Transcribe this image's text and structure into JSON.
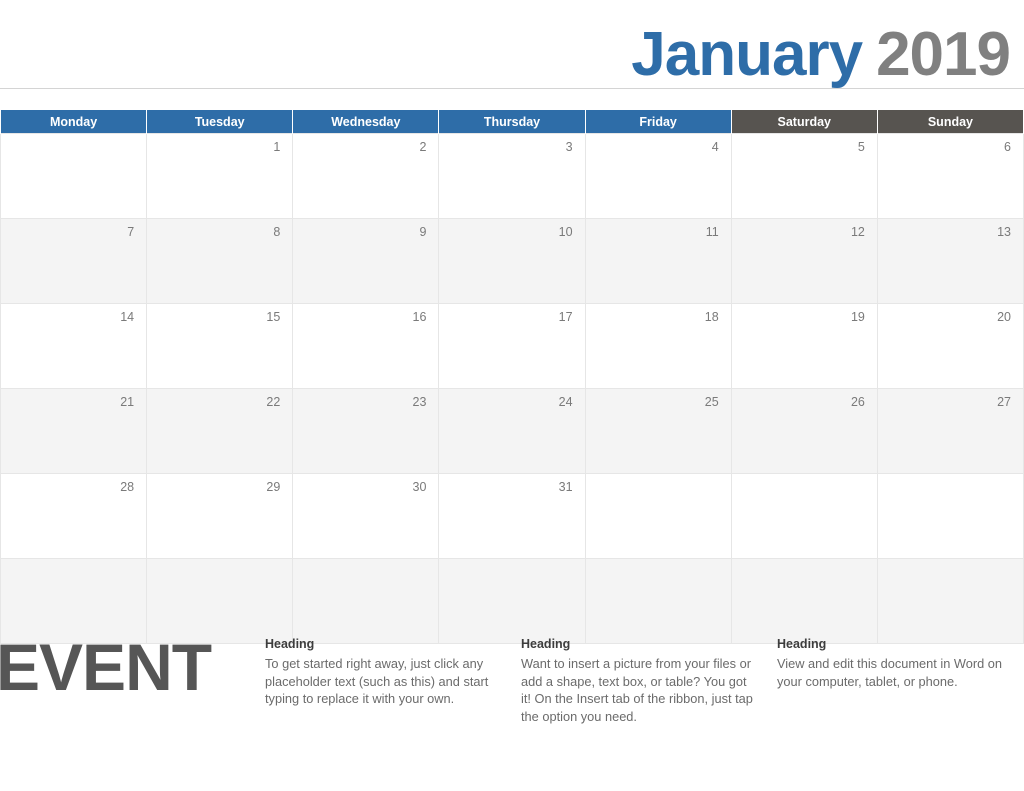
{
  "header": {
    "month": "January",
    "year": "2019",
    "month_color": "#2E6DA8",
    "year_color": "#808080"
  },
  "calendar": {
    "weekday_header_color": "#2E6DA8",
    "weekend_header_color": "#575450",
    "shaded_row_color": "#F4F4F4",
    "day_names": [
      "Monday",
      "Tuesday",
      "Wednesday",
      "Thursday",
      "Friday",
      "Saturday",
      "Sunday"
    ],
    "weeks": [
      [
        "",
        "1",
        "2",
        "3",
        "4",
        "5",
        "6"
      ],
      [
        "7",
        "8",
        "9",
        "10",
        "11",
        "12",
        "13"
      ],
      [
        "14",
        "15",
        "16",
        "17",
        "18",
        "19",
        "20"
      ],
      [
        "21",
        "22",
        "23",
        "24",
        "25",
        "26",
        "27"
      ],
      [
        "28",
        "29",
        "30",
        "31",
        "",
        "",
        ""
      ],
      [
        "",
        "",
        "",
        "",
        "",
        "",
        ""
      ]
    ]
  },
  "bottom": {
    "event_word": "EVENT",
    "columns": [
      {
        "heading": "Heading",
        "body": "To get started right away, just click any placeholder text (such as this) and start typing to replace it with your own."
      },
      {
        "heading": "Heading",
        "body": "Want to insert a picture from your files or add a shape, text box, or table? You got it! On the Insert tab of the ribbon, just tap the option you need."
      },
      {
        "heading": "Heading",
        "body": "View and edit this document in Word on your computer, tablet, or phone."
      }
    ]
  }
}
